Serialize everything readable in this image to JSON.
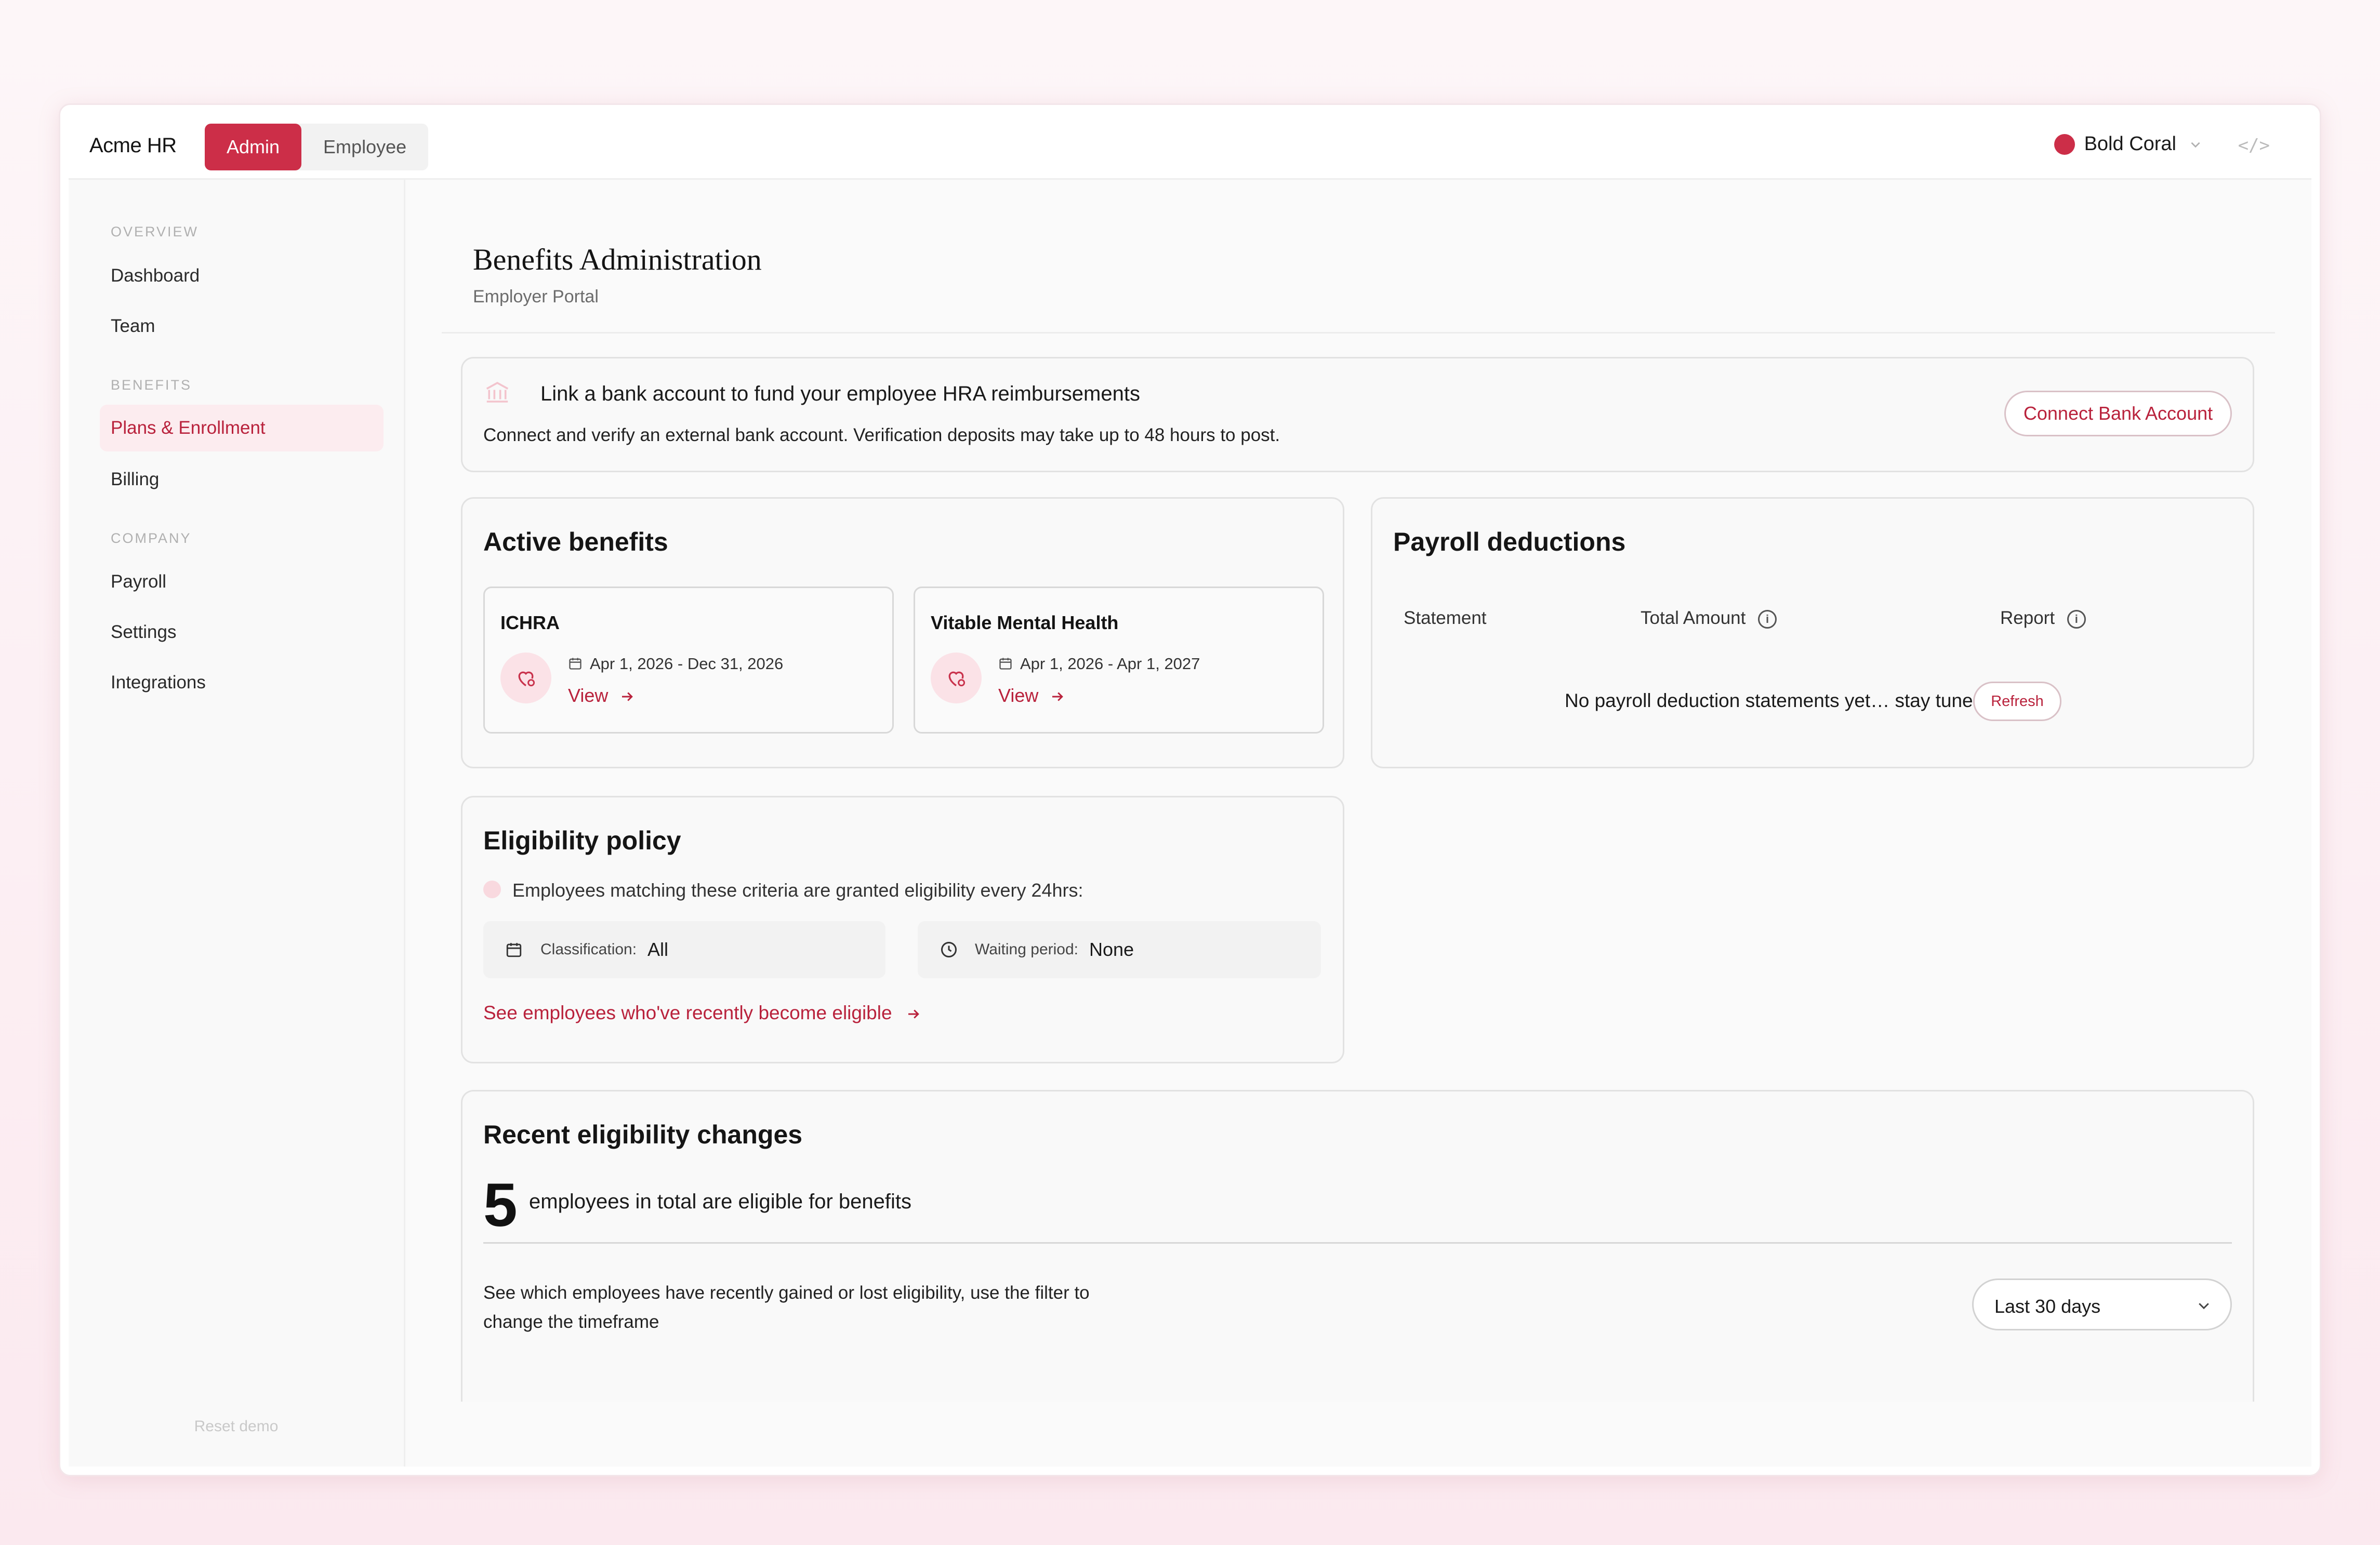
{
  "app": {
    "brand": "Acme HR",
    "modes": [
      "Admin",
      "Employee"
    ],
    "active_mode": "Admin"
  },
  "theme": {
    "label": "Bold Coral",
    "color": "#cc2e48",
    "code_label": "</>"
  },
  "sidebar": {
    "sections": [
      {
        "title": "OVERVIEW",
        "items": [
          "Dashboard",
          "Team"
        ]
      },
      {
        "title": "BENEFITS",
        "items": [
          "Plans & Enrollment",
          "Billing"
        ]
      },
      {
        "title": "COMPANY",
        "items": [
          "Payroll",
          "Settings",
          "Integrations"
        ]
      }
    ],
    "active_item": "Plans & Enrollment",
    "reset_label": "Reset demo"
  },
  "page": {
    "title": "Benefits Administration",
    "subtitle": "Employer Portal"
  },
  "bank_banner": {
    "icon": "bank-icon",
    "heading": "Link a bank account to fund your employee HRA reimbursements",
    "body": "Connect and verify an external bank account. Verification deposits may take up to 48 hours to post.",
    "button": "Connect Bank Account"
  },
  "active_benefits": {
    "title": "Active benefits",
    "plans": [
      {
        "name": "ICHRA",
        "dates": "Apr 1, 2026 - Dec 31, 2026",
        "link": "View"
      },
      {
        "name": "Vitable Mental Health",
        "dates": "Apr 1, 2026 - Apr 1, 2027",
        "link": "View"
      }
    ]
  },
  "payroll": {
    "title": "Payroll deductions",
    "columns": [
      "Statement",
      "Total Amount",
      "Report"
    ],
    "empty_text": "No payroll deduction statements yet… stay tuned!",
    "refresh": "Refresh"
  },
  "eligibility": {
    "title": "Eligibility policy",
    "criteria_text": "Employees matching these criteria are granted eligibility every 24hrs:",
    "classification_label": "Classification:",
    "classification_value": "All",
    "waiting_label": "Waiting period:",
    "waiting_value": "None",
    "link": "See employees who've recently become eligible"
  },
  "recent_changes": {
    "title": "Recent eligibility changes",
    "count": "5",
    "count_text": "employees in total are eligible for benefits",
    "description": "See which employees have recently gained or lost eligibility, use the filter to change the timeframe",
    "filter": "Last 30 days"
  }
}
